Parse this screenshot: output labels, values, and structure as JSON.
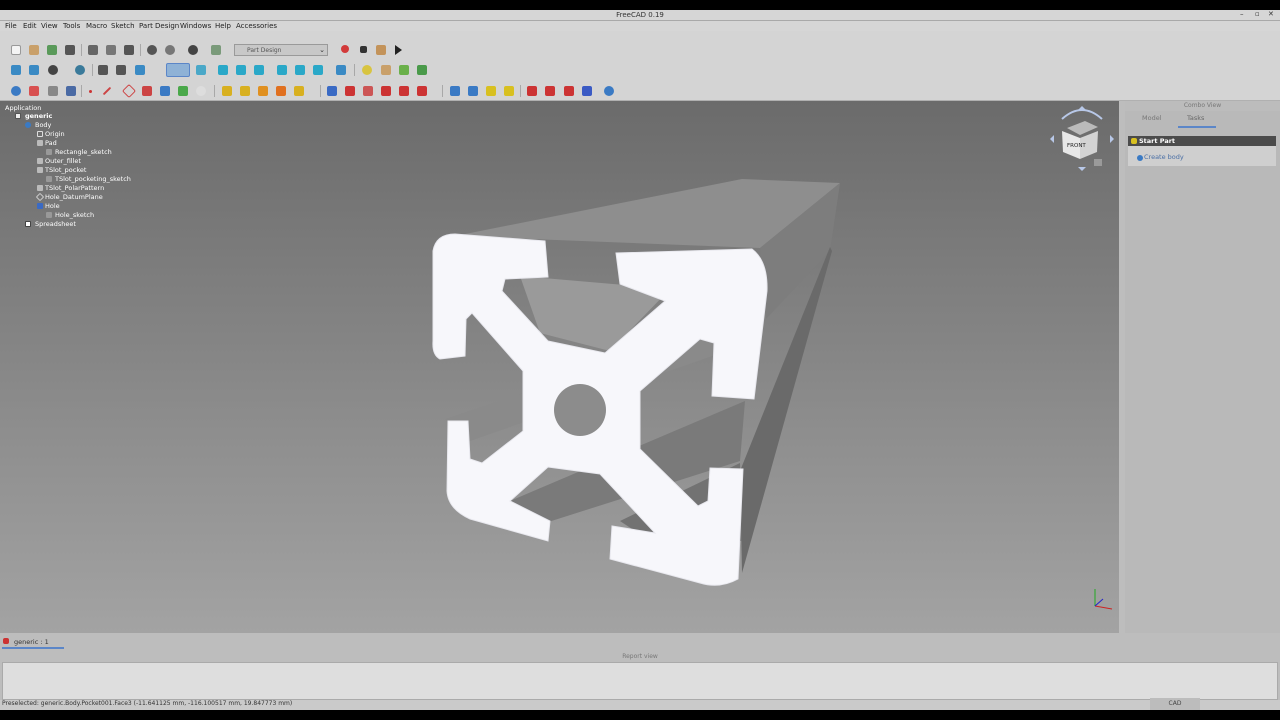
{
  "window": {
    "title": "FreeCAD 0.19",
    "controls": [
      "–",
      "▫",
      "✕"
    ]
  },
  "menu": [
    "File",
    "Edit",
    "View",
    "Tools",
    "Macro",
    "Sketch",
    "Part Design",
    "Windows",
    "Help",
    "Accessories"
  ],
  "toolbar": {
    "workbench_selector": "Part Design"
  },
  "tree": {
    "section_label": "Application",
    "items": [
      {
        "label": "generic",
        "icon": "document-icon"
      },
      {
        "label": "Body",
        "icon": "body-icon"
      },
      {
        "label": "Origin",
        "icon": "origin-icon"
      },
      {
        "label": "Pad",
        "icon": "pad-icon"
      },
      {
        "label": "Rectangle_sketch",
        "icon": "sketch-icon"
      },
      {
        "label": "Outer_fillet",
        "icon": "fillet-icon"
      },
      {
        "label": "TSlot_pocket",
        "icon": "pocket-icon"
      },
      {
        "label": "TSlot_pocketing_sketch",
        "icon": "sketch-icon"
      },
      {
        "label": "TSlot_PolarPattern",
        "icon": "polar-pattern-icon"
      },
      {
        "label": "Hole_DatumPlane",
        "icon": "datum-plane-icon"
      },
      {
        "label": "Hole",
        "icon": "hole-icon"
      },
      {
        "label": "Hole_sketch",
        "icon": "sketch-icon"
      },
      {
        "label": "Spreadsheet",
        "icon": "spreadsheet-icon"
      }
    ]
  },
  "navcube": {
    "face_label": "FRONT"
  },
  "combo": {
    "title": "Combo View",
    "tabs": [
      "Model",
      "Tasks"
    ],
    "active_tab": "Tasks",
    "panel_title": "Start Part",
    "panel_action": "Create body"
  },
  "doc_tab": {
    "label": "generic : 1"
  },
  "report": {
    "title": "Report view"
  },
  "status": {
    "text": "Preselected: generic.Body.Pocket001.Face3 (-11.641125 mm, -116.100517 mm, 19.847773 mm)",
    "navigation_style": "CAD"
  },
  "colors": {
    "accent": "#5b86c8",
    "viewport_top": "#6b6b6b",
    "viewport_bottom": "#a3a3a3",
    "model_face": "#f7f7fb"
  }
}
